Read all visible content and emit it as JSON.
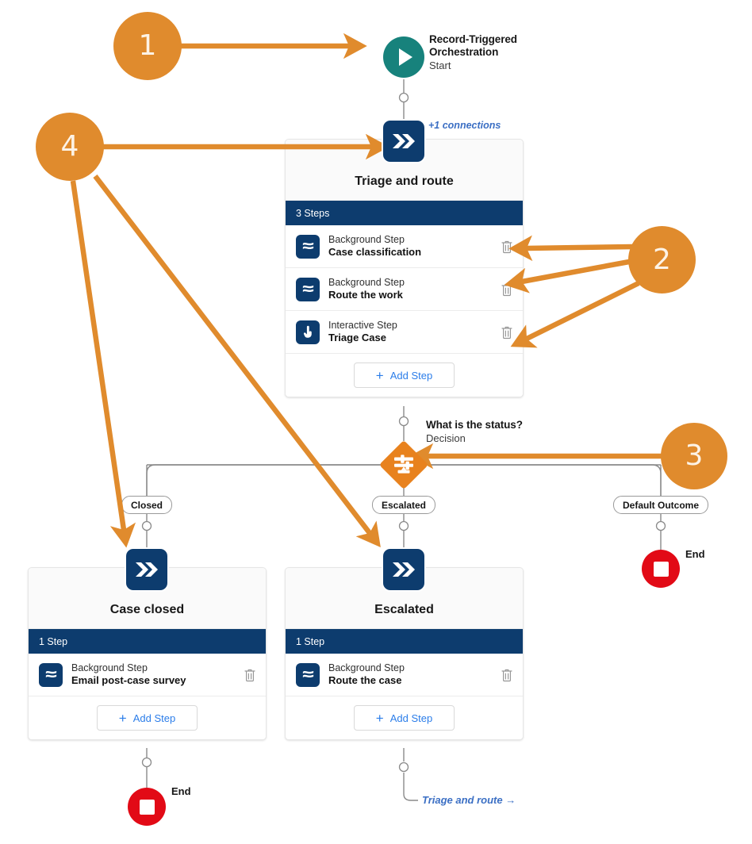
{
  "diagram": {
    "type": "salesforce-orchestration-flow-canvas",
    "accent_orange": "#e08b2d",
    "node_navy": "#0d3c6e",
    "start_teal": "#17827c",
    "decision_orange": "#e8821e",
    "end_red": "#e20a16",
    "link_blue": "#3b6fc4"
  },
  "start": {
    "title_line1": "Record-Triggered",
    "title_line2": "Orchestration",
    "subtitle": "Start",
    "icon": "play-icon"
  },
  "connections_label": "+1 connections",
  "stages": {
    "triage": {
      "badge_icon": "double-chevron-icon",
      "title": "Triage and route",
      "steps_count_label": "3 Steps",
      "steps": [
        {
          "kind": "Background Step",
          "name": "Case classification",
          "icon": "background-step-icon",
          "delete_icon": "trash-icon"
        },
        {
          "kind": "Background Step",
          "name": "Route the work",
          "icon": "background-step-icon",
          "delete_icon": "trash-icon"
        },
        {
          "kind": "Interactive Step",
          "name": "Triage Case",
          "icon": "interactive-step-icon",
          "delete_icon": "trash-icon"
        }
      ],
      "add_step_label": "Add Step"
    },
    "case_closed": {
      "badge_icon": "double-chevron-icon",
      "title": "Case closed",
      "steps_count_label": "1 Step",
      "steps": [
        {
          "kind": "Background Step",
          "name": "Email post-case survey",
          "icon": "background-step-icon",
          "delete_icon": "trash-icon"
        }
      ],
      "add_step_label": "Add Step"
    },
    "escalated": {
      "badge_icon": "double-chevron-icon",
      "title": "Escalated",
      "steps_count_label": "1 Step",
      "steps": [
        {
          "kind": "Background Step",
          "name": "Route the case",
          "icon": "background-step-icon",
          "delete_icon": "trash-icon"
        }
      ],
      "add_step_label": "Add Step"
    }
  },
  "decision": {
    "title": "What is the status?",
    "subtitle": "Decision",
    "icon": "decision-diamond-icon",
    "outcomes": [
      "Closed",
      "Escalated",
      "Default Outcome"
    ]
  },
  "ends": {
    "right_label": "End",
    "left_label": "End",
    "icon": "end-stop-icon"
  },
  "goto_link": {
    "label": "Triage and route",
    "arrow": "→",
    "icon": "arrow-right-icon"
  },
  "callouts": [
    {
      "number": "1",
      "target": "start-node"
    },
    {
      "number": "2",
      "target": "triage-steps"
    },
    {
      "number": "3",
      "target": "decision-node"
    },
    {
      "number": "4",
      "target": "stage-badges"
    }
  ]
}
